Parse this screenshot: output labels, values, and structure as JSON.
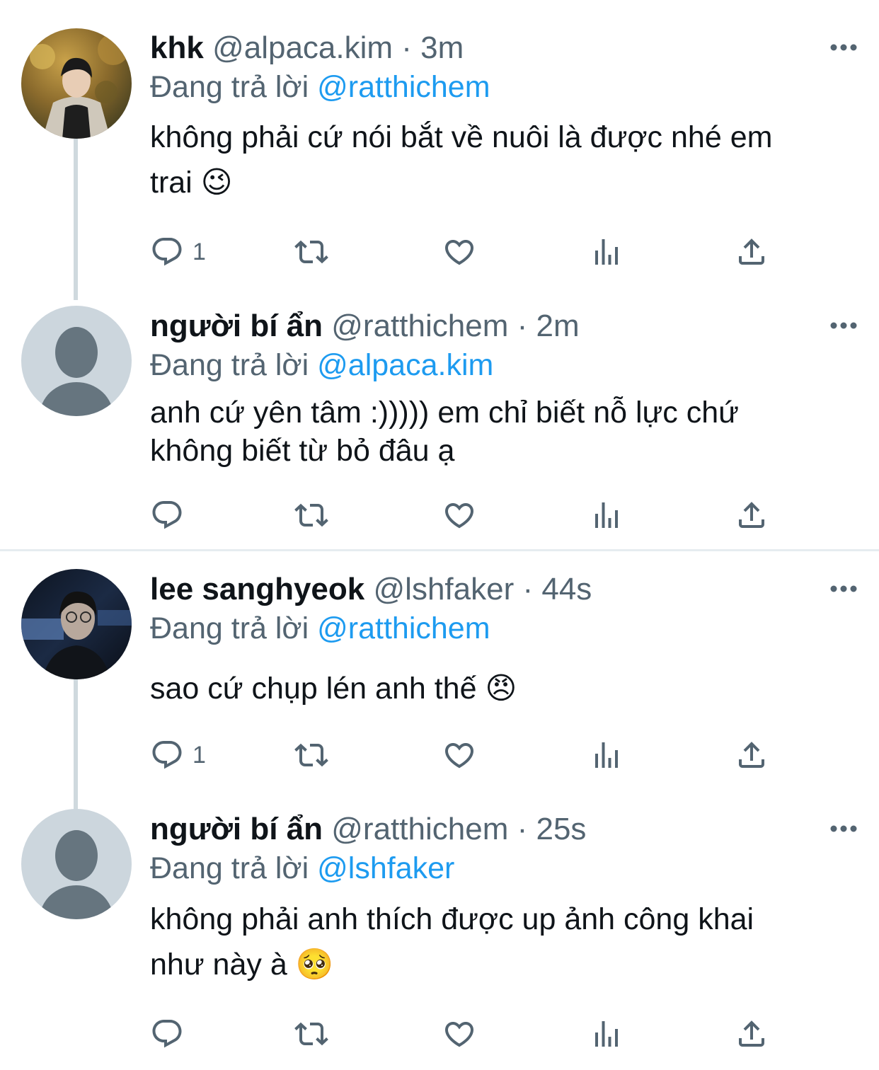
{
  "tweets": [
    {
      "name": "khk",
      "handle": "@alpaca.kim",
      "time": "3m",
      "reply_label": "Đang trả lời",
      "reply_to": "@ratthichem",
      "text_line1": "không phải cứ nói bắt về nuôi là được nhé em",
      "text_line2": "trai",
      "emoji": "😉",
      "reply_count": "1",
      "avatar": "photo-person-autumn"
    },
    {
      "name": "người bí ẩn",
      "handle": "@ratthichem",
      "time": "2m",
      "reply_label": "Đang trả lời",
      "reply_to": "@alpaca.kim",
      "text_line1": "anh cứ yên tâm :))))) em chỉ biết nỗ lực chứ",
      "text_line2": "không biết từ bỏ đâu ạ",
      "emoji": "",
      "reply_count": "",
      "avatar": "default-avatar"
    },
    {
      "name": "lee sanghyeok",
      "handle": "@lshfaker",
      "time": "44s",
      "reply_label": "Đang trả lời",
      "reply_to": "@ratthichem",
      "text_line1": "sao cứ chụp lén anh thế",
      "text_line2": "",
      "emoji": "😠",
      "reply_count": "1",
      "avatar": "photo-person-dark"
    },
    {
      "name": "người bí ẩn",
      "handle": "@ratthichem",
      "time": "25s",
      "reply_label": "Đang trả lời",
      "reply_to": "@lshfaker",
      "text_line1": "không phải anh thích được up ảnh công khai",
      "text_line2": "như này à",
      "emoji": "🥺",
      "reply_count": "",
      "avatar": "default-avatar"
    }
  ],
  "icons": {
    "reply": "reply-icon",
    "retweet": "retweet-icon",
    "like": "heart-icon",
    "views": "analytics-icon",
    "share": "share-icon",
    "more": "more-icon"
  },
  "colors": {
    "link": "#1d9bf0",
    "secondary": "#536471",
    "thread_line": "#cfd9de",
    "default_avatar_bg": "#ccd6dd",
    "default_avatar_fg": "#66757f"
  }
}
